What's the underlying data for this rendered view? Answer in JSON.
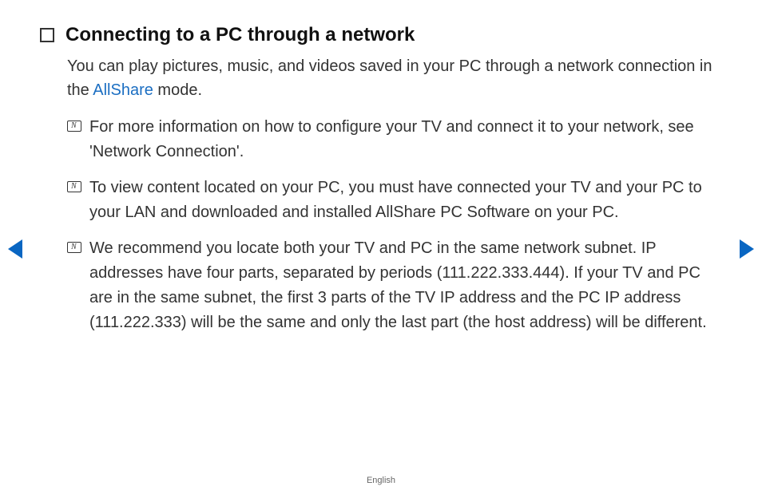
{
  "heading": "Connecting to a PC through a network",
  "intro": {
    "part1": "You can play pictures, music, and videos saved in your PC through a network connection in the ",
    "allshare": "AllShare",
    "part2": " mode."
  },
  "notes": [
    "For more information on how to configure your TV and connect it to your network, see 'Network Connection'.",
    "To view content located on your PC, you must have connected your TV and your PC to your LAN and downloaded and installed AllShare PC Software on your PC.",
    "We recommend you locate both your TV and PC in the same network subnet. IP addresses have four parts, separated by periods (111.222.333.444). If your TV and PC are in the same subnet, the first 3 parts of the TV IP address and the PC IP address (111.222.333) will be the same and only the last part (the host address) will be different."
  ],
  "footer": "English"
}
